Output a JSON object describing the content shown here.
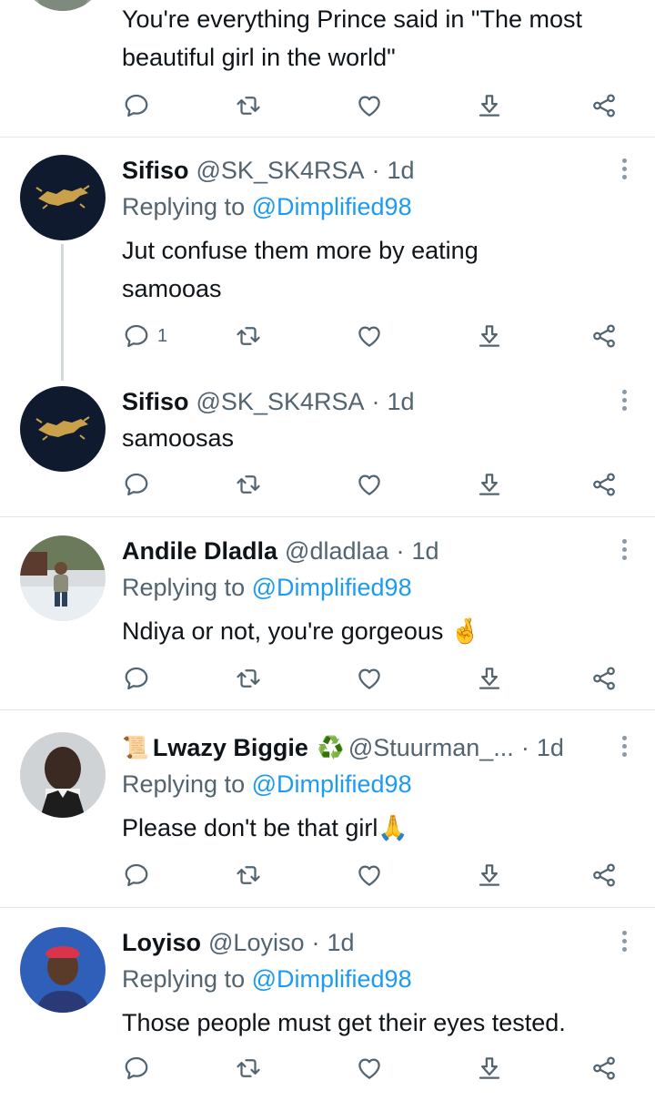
{
  "tweets": [
    {
      "text": "You're everything Prince said in \"The most beautiful girl in the world\"",
      "actions": {
        "reply_count": "",
        "retweet_count": "",
        "like_count": ""
      }
    },
    {
      "name": "Sifiso",
      "handle": "@SK_SK4RSA",
      "sep": "·",
      "time": "1d",
      "replying_prefix": "Replying to",
      "replying_to": "@Dimplified98",
      "text": "Jut confuse them more by eating samooas",
      "actions": {
        "reply_count": "1"
      }
    },
    {
      "name": "Sifiso",
      "handle": "@SK_SK4RSA",
      "sep": "·",
      "time": "1d",
      "text": "samoosas"
    },
    {
      "name": "Andile Dladla",
      "handle": "@dladlaa",
      "sep": "·",
      "time": "1d",
      "replying_prefix": "Replying to",
      "replying_to": "@Dimplified98",
      "text": "Ndiya or not, you're gorgeous 🤞"
    },
    {
      "name_prefix_emoji": "📜",
      "name": "Lwazy Biggie",
      "name_suffix_emoji": "♻️",
      "handle": "@Stuurman_...",
      "sep": "·",
      "time": "1d",
      "replying_prefix": "Replying to",
      "replying_to": "@Dimplified98",
      "text": "Please don't be that girl🙏"
    },
    {
      "name": "Loyiso",
      "handle": "@Loyiso",
      "sep": "·",
      "time": "1d",
      "replying_prefix": "Replying to",
      "replying_to": "@Dimplified98",
      "text": "Those people must get their eyes tested."
    }
  ],
  "colors": {
    "link": "#1d9bf0",
    "secondary": "#536471",
    "divider": "#e1e6ea"
  },
  "icons": [
    "reply-icon",
    "retweet-icon",
    "like-icon",
    "download-icon",
    "share-icon",
    "more-icon"
  ]
}
